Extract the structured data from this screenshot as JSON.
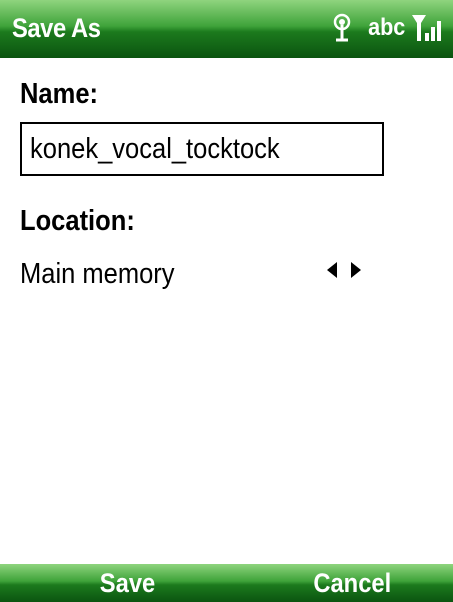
{
  "title_bar": {
    "title": "Save As",
    "input_mode": "abc",
    "icons": [
      "antenna-icon",
      "signal-strength-icon"
    ]
  },
  "form": {
    "name_label": "Name:",
    "name_value": "konek_vocal_tocktock",
    "location_label": "Location:",
    "location_value": "Main memory",
    "location_spinner_icons": [
      "arrow-left-icon",
      "arrow-right-icon"
    ]
  },
  "softkeys": {
    "left": "Save",
    "right": "Cancel"
  },
  "colors": {
    "bar_green_light": "#8fd47e",
    "bar_green_dark": "#0b5410",
    "text": "#000000",
    "background": "#ffffff"
  }
}
